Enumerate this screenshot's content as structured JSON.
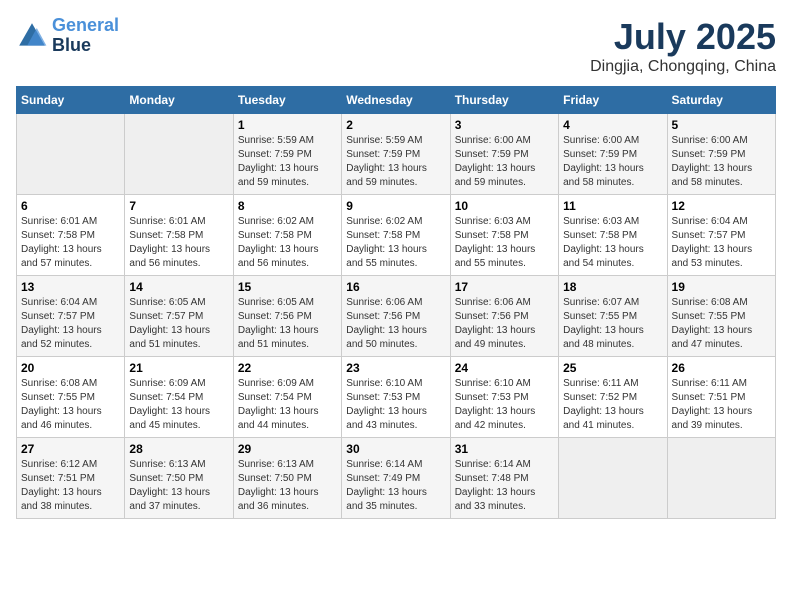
{
  "header": {
    "logo_line1": "General",
    "logo_line2": "Blue",
    "month": "July 2025",
    "location": "Dingjia, Chongqing, China"
  },
  "weekdays": [
    "Sunday",
    "Monday",
    "Tuesday",
    "Wednesday",
    "Thursday",
    "Friday",
    "Saturday"
  ],
  "weeks": [
    [
      {
        "day": "",
        "info": ""
      },
      {
        "day": "",
        "info": ""
      },
      {
        "day": "1",
        "info": "Sunrise: 5:59 AM\nSunset: 7:59 PM\nDaylight: 13 hours and 59 minutes."
      },
      {
        "day": "2",
        "info": "Sunrise: 5:59 AM\nSunset: 7:59 PM\nDaylight: 13 hours and 59 minutes."
      },
      {
        "day": "3",
        "info": "Sunrise: 6:00 AM\nSunset: 7:59 PM\nDaylight: 13 hours and 59 minutes."
      },
      {
        "day": "4",
        "info": "Sunrise: 6:00 AM\nSunset: 7:59 PM\nDaylight: 13 hours and 58 minutes."
      },
      {
        "day": "5",
        "info": "Sunrise: 6:00 AM\nSunset: 7:59 PM\nDaylight: 13 hours and 58 minutes."
      }
    ],
    [
      {
        "day": "6",
        "info": "Sunrise: 6:01 AM\nSunset: 7:58 PM\nDaylight: 13 hours and 57 minutes."
      },
      {
        "day": "7",
        "info": "Sunrise: 6:01 AM\nSunset: 7:58 PM\nDaylight: 13 hours and 56 minutes."
      },
      {
        "day": "8",
        "info": "Sunrise: 6:02 AM\nSunset: 7:58 PM\nDaylight: 13 hours and 56 minutes."
      },
      {
        "day": "9",
        "info": "Sunrise: 6:02 AM\nSunset: 7:58 PM\nDaylight: 13 hours and 55 minutes."
      },
      {
        "day": "10",
        "info": "Sunrise: 6:03 AM\nSunset: 7:58 PM\nDaylight: 13 hours and 55 minutes."
      },
      {
        "day": "11",
        "info": "Sunrise: 6:03 AM\nSunset: 7:58 PM\nDaylight: 13 hours and 54 minutes."
      },
      {
        "day": "12",
        "info": "Sunrise: 6:04 AM\nSunset: 7:57 PM\nDaylight: 13 hours and 53 minutes."
      }
    ],
    [
      {
        "day": "13",
        "info": "Sunrise: 6:04 AM\nSunset: 7:57 PM\nDaylight: 13 hours and 52 minutes."
      },
      {
        "day": "14",
        "info": "Sunrise: 6:05 AM\nSunset: 7:57 PM\nDaylight: 13 hours and 51 minutes."
      },
      {
        "day": "15",
        "info": "Sunrise: 6:05 AM\nSunset: 7:56 PM\nDaylight: 13 hours and 51 minutes."
      },
      {
        "day": "16",
        "info": "Sunrise: 6:06 AM\nSunset: 7:56 PM\nDaylight: 13 hours and 50 minutes."
      },
      {
        "day": "17",
        "info": "Sunrise: 6:06 AM\nSunset: 7:56 PM\nDaylight: 13 hours and 49 minutes."
      },
      {
        "day": "18",
        "info": "Sunrise: 6:07 AM\nSunset: 7:55 PM\nDaylight: 13 hours and 48 minutes."
      },
      {
        "day": "19",
        "info": "Sunrise: 6:08 AM\nSunset: 7:55 PM\nDaylight: 13 hours and 47 minutes."
      }
    ],
    [
      {
        "day": "20",
        "info": "Sunrise: 6:08 AM\nSunset: 7:55 PM\nDaylight: 13 hours and 46 minutes."
      },
      {
        "day": "21",
        "info": "Sunrise: 6:09 AM\nSunset: 7:54 PM\nDaylight: 13 hours and 45 minutes."
      },
      {
        "day": "22",
        "info": "Sunrise: 6:09 AM\nSunset: 7:54 PM\nDaylight: 13 hours and 44 minutes."
      },
      {
        "day": "23",
        "info": "Sunrise: 6:10 AM\nSunset: 7:53 PM\nDaylight: 13 hours and 43 minutes."
      },
      {
        "day": "24",
        "info": "Sunrise: 6:10 AM\nSunset: 7:53 PM\nDaylight: 13 hours and 42 minutes."
      },
      {
        "day": "25",
        "info": "Sunrise: 6:11 AM\nSunset: 7:52 PM\nDaylight: 13 hours and 41 minutes."
      },
      {
        "day": "26",
        "info": "Sunrise: 6:11 AM\nSunset: 7:51 PM\nDaylight: 13 hours and 39 minutes."
      }
    ],
    [
      {
        "day": "27",
        "info": "Sunrise: 6:12 AM\nSunset: 7:51 PM\nDaylight: 13 hours and 38 minutes."
      },
      {
        "day": "28",
        "info": "Sunrise: 6:13 AM\nSunset: 7:50 PM\nDaylight: 13 hours and 37 minutes."
      },
      {
        "day": "29",
        "info": "Sunrise: 6:13 AM\nSunset: 7:50 PM\nDaylight: 13 hours and 36 minutes."
      },
      {
        "day": "30",
        "info": "Sunrise: 6:14 AM\nSunset: 7:49 PM\nDaylight: 13 hours and 35 minutes."
      },
      {
        "day": "31",
        "info": "Sunrise: 6:14 AM\nSunset: 7:48 PM\nDaylight: 13 hours and 33 minutes."
      },
      {
        "day": "",
        "info": ""
      },
      {
        "day": "",
        "info": ""
      }
    ]
  ]
}
